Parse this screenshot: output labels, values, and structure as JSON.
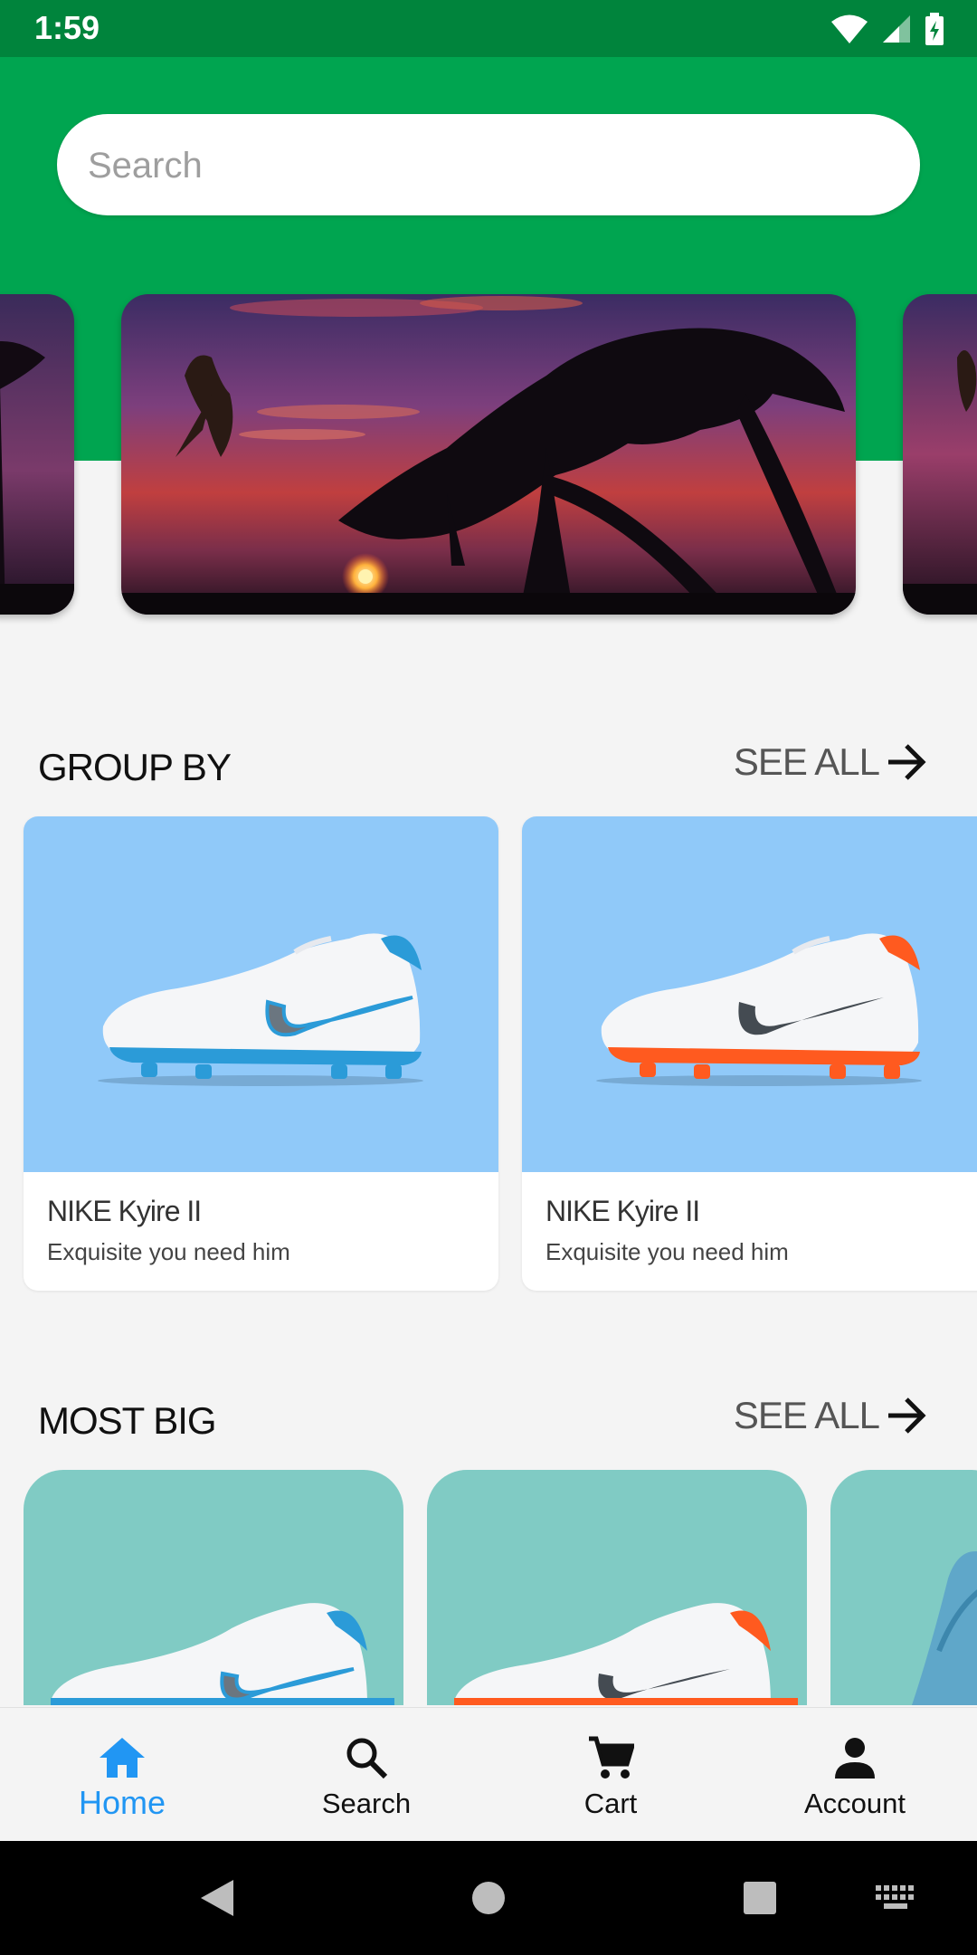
{
  "status_bar": {
    "time": "1:59"
  },
  "search": {
    "placeholder": "Search"
  },
  "sections": {
    "group_by": {
      "title": "GROUP BY",
      "see_all": "SEE ALL"
    },
    "most_big": {
      "title": "MOST BIG",
      "see_all": "SEE ALL"
    }
  },
  "group_by_products": [
    {
      "title": "NIKE Kyire II",
      "subtitle": "Exquisite you need him",
      "accent": "#2b9bd8"
    },
    {
      "title": "NIKE Kyire II",
      "subtitle": "Exquisite you need him",
      "accent": "#ff5a1f"
    }
  ],
  "bottom_nav": [
    {
      "label": "Home",
      "icon": "home-icon",
      "active": true
    },
    {
      "label": "Search",
      "icon": "search-icon",
      "active": false
    },
    {
      "label": "Cart",
      "icon": "cart-icon",
      "active": false
    },
    {
      "label": "Account",
      "icon": "account-icon",
      "active": false
    }
  ],
  "colors": {
    "status_bar": "#00843c",
    "header": "#00a550",
    "active_nav": "#2196f3",
    "group_card_bg": "#90c9f9",
    "most_big_card_bg": "#80cbc4"
  }
}
